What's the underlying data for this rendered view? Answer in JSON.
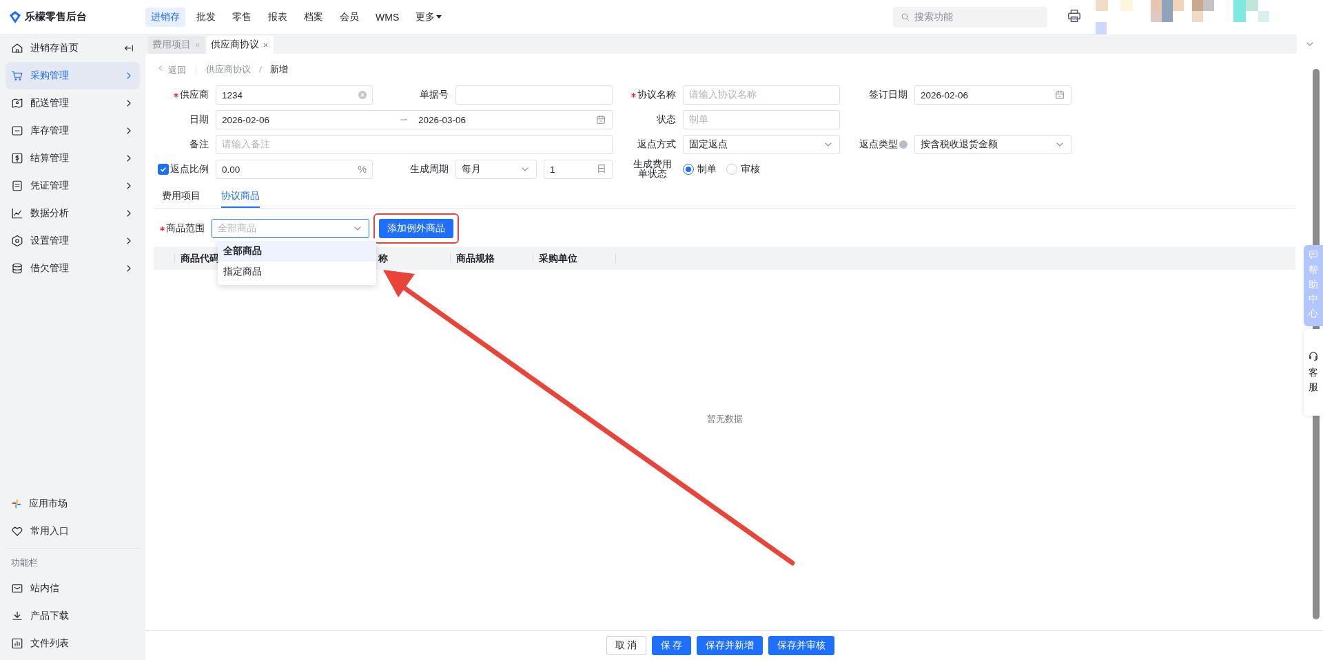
{
  "app": {
    "title": "乐檬零售后台"
  },
  "top_nav": [
    {
      "label": "进销存",
      "selected": true,
      "kind": "link"
    },
    {
      "label": "批发",
      "selected": false,
      "kind": "link"
    },
    {
      "label": "零售",
      "selected": false,
      "kind": "link"
    },
    {
      "label": "报表",
      "selected": false,
      "kind": "link"
    },
    {
      "label": "档案",
      "selected": false,
      "kind": "link"
    },
    {
      "label": "会员",
      "selected": false,
      "kind": "link"
    },
    {
      "label": "WMS",
      "selected": false,
      "kind": "link"
    },
    {
      "label": "更多",
      "selected": false,
      "kind": "menu"
    }
  ],
  "search": {
    "placeholder": "搜索功能"
  },
  "sidebar": {
    "items": [
      {
        "label": "进销存首页",
        "selected": false,
        "kind": "home"
      },
      {
        "label": "采购管理",
        "selected": true,
        "kind": "group"
      },
      {
        "label": "配送管理",
        "selected": false,
        "kind": "group"
      },
      {
        "label": "库存管理",
        "selected": false,
        "kind": "group"
      },
      {
        "label": "结算管理",
        "selected": false,
        "kind": "group"
      },
      {
        "label": "凭证管理",
        "selected": false,
        "kind": "group"
      },
      {
        "label": "数据分析",
        "selected": false,
        "kind": "group"
      },
      {
        "label": "设置管理",
        "selected": false,
        "kind": "group"
      },
      {
        "label": "借欠管理",
        "selected": false,
        "kind": "group"
      }
    ],
    "bottom_items": [
      {
        "label": "应用市场"
      },
      {
        "label": "常用入口"
      }
    ],
    "section_title": "功能栏",
    "tool_items": [
      {
        "label": "站内信"
      },
      {
        "label": "产品下载"
      },
      {
        "label": "文件列表"
      }
    ]
  },
  "page_tabs": [
    {
      "label": "费用项目",
      "selected": false
    },
    {
      "label": "供应商协议",
      "selected": true
    }
  ],
  "breadcrumb": {
    "back": "返回",
    "path": [
      "供应商协议",
      "新增"
    ]
  },
  "form": {
    "rows": [
      [
        {
          "kind": "clearable",
          "label": "供应商",
          "required": true,
          "help_icon": false,
          "value": "1234"
        },
        {
          "kind": "text",
          "label": "单据号",
          "required": false,
          "help_icon": false
        },
        {
          "kind": "text",
          "label": "协议名称",
          "required": true,
          "help_icon": false,
          "placeholder": "请输入协议名称"
        },
        {
          "kind": "date",
          "label": "签订日期",
          "required": false,
          "help_icon": false,
          "value": "2026-02-06"
        }
      ],
      [
        {
          "kind": "daterange",
          "label": "日期",
          "required": false,
          "help_icon": false,
          "start": "2026-02-06",
          "end": "2026-03-06"
        },
        "",
        {
          "kind": "text",
          "label": "状态",
          "required": false,
          "help_icon": false,
          "placeholder": "制单"
        }
      ],
      [
        {
          "kind": "wide_text",
          "label": "备注",
          "required": false,
          "help_icon": false,
          "placeholder": "请输入备注"
        },
        "",
        {
          "kind": "select",
          "label": "返点方式",
          "required": false,
          "help_icon": false,
          "value": "固定返点"
        },
        {
          "kind": "select",
          "label": "返点类型",
          "required": false,
          "help_icon": true,
          "value": "按含税收退货金额"
        }
      ],
      [
        {
          "kind": "check_percent",
          "label": "返点比例",
          "required": false,
          "help_icon": false,
          "checked": true,
          "value": "0.00",
          "suffix": "%"
        },
        {
          "kind": "cycle",
          "label": "生成周期",
          "required": false,
          "help_icon": false,
          "value": "每月",
          "count": "1",
          "unit": "日"
        },
        {
          "kind": "radio",
          "label": "生成费用单状态",
          "required": false,
          "help_icon": false,
          "options": [
            {
              "label": "制单",
              "selected": true
            },
            {
              "label": "审核",
              "selected": false
            }
          ]
        }
      ]
    ]
  },
  "sub_tabs": [
    {
      "label": "费用项目",
      "selected": false
    },
    {
      "label": "协议商品",
      "selected": true
    }
  ],
  "scope": {
    "label": "商品范围",
    "required": true,
    "placeholder": "全部商品",
    "button": "添加例外商品",
    "options": [
      {
        "label": "全部商品",
        "selected": true
      },
      {
        "label": "指定商品",
        "selected": false
      }
    ]
  },
  "table": {
    "columns": [
      "商品代码",
      "称",
      "商品规格",
      "采购单位"
    ],
    "empty_text": "暂无数据"
  },
  "footer_buttons": [
    {
      "label": "取 消",
      "kind": "default"
    },
    {
      "label": "保 存",
      "kind": "primary"
    },
    {
      "label": "保存并新增",
      "kind": "primary"
    },
    {
      "label": "保存并审核",
      "kind": "primary"
    }
  ],
  "float_panel": {
    "help": "帮助中心",
    "service": "客服"
  }
}
